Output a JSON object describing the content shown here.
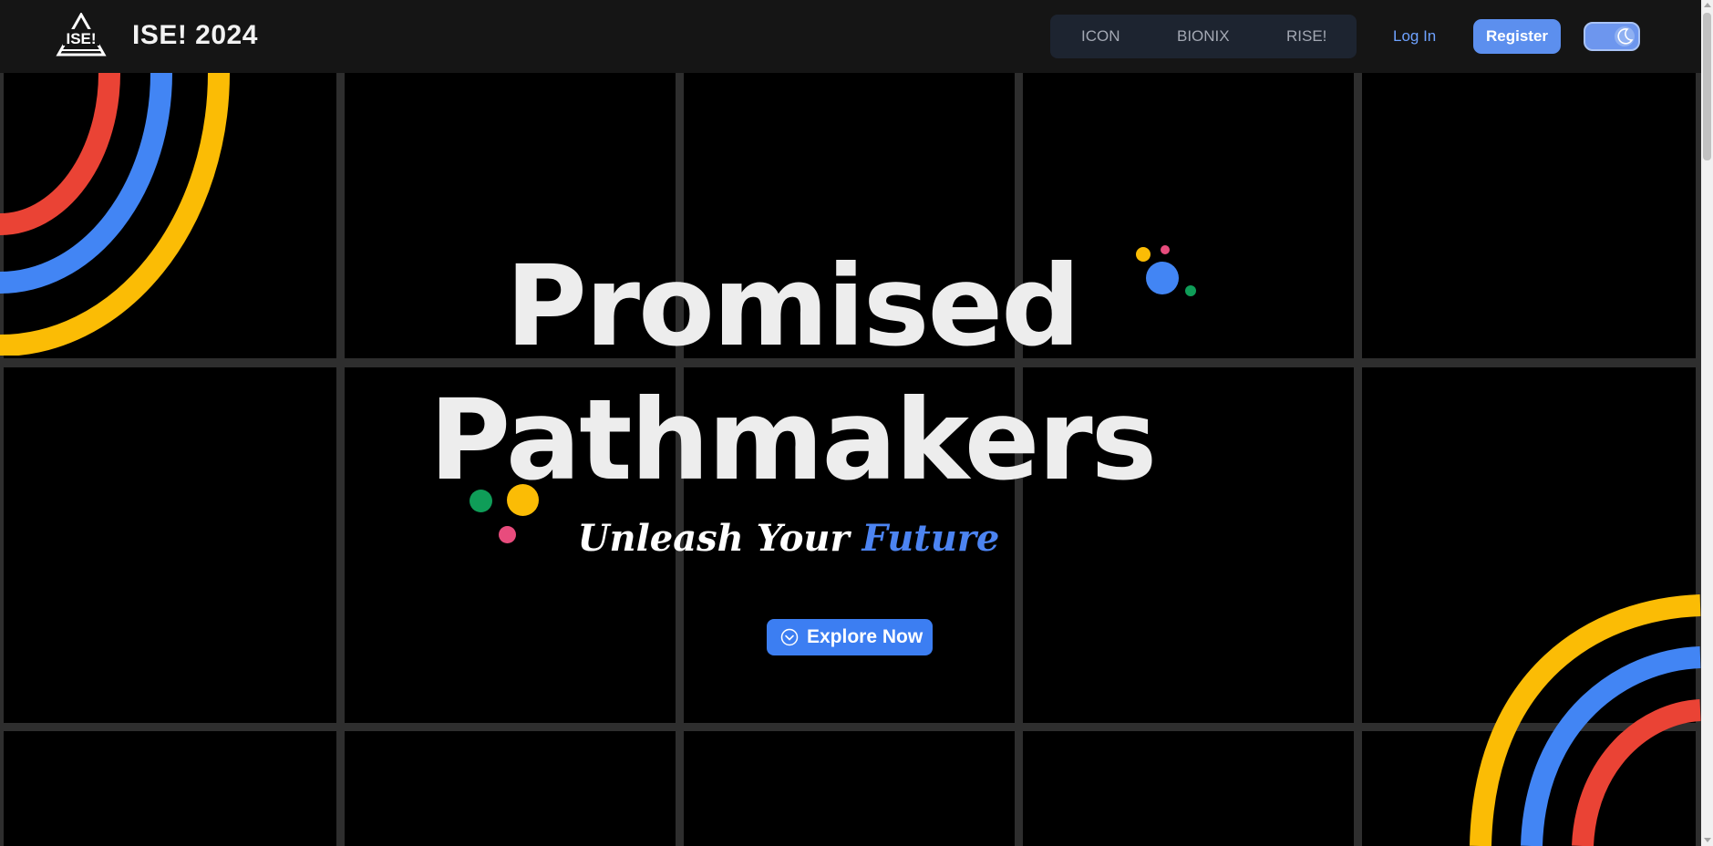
{
  "header": {
    "site_title": "ISE! 2024",
    "logo_text": "ISE!",
    "nav": [
      {
        "label": "ICON"
      },
      {
        "label": "BIONIX"
      },
      {
        "label": "RISE!"
      }
    ],
    "login_label": "Log In",
    "register_label": "Register",
    "theme_toggle_icon": "moon-icon"
  },
  "hero": {
    "title_line_1": "Promised",
    "title_line_2": "Pathmakers",
    "tagline_main": "Unleash Your",
    "tagline_accent": "Future",
    "explore_label": "Explore Now",
    "explore_icon": "chevron-down-circle-icon"
  },
  "colors": {
    "background": "#000000",
    "grid_line": "#2e2e2e",
    "header_bg": "#151515",
    "accent_blue": "#4285f4",
    "accent_red": "#ea4335",
    "accent_yellow": "#fbbc05",
    "accent_green": "#0f9d58",
    "accent_pink": "#e84c7d"
  }
}
